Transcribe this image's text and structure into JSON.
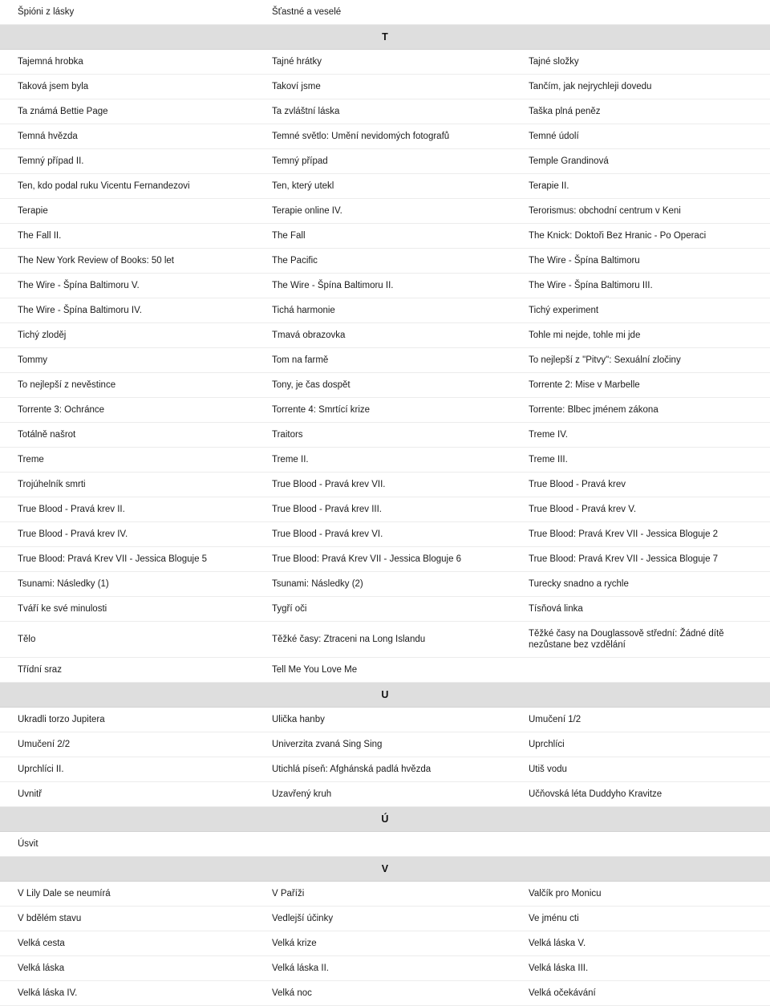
{
  "page": {
    "title": "Czech Title Index",
    "columns": 3,
    "colors": {
      "page_background": "#ffffff",
      "section_band_background": "#dedede",
      "row_separator": "#ececec",
      "text": "#1b1b1b"
    }
  },
  "blocks": [
    {
      "type": "rows",
      "rows": [
        [
          "Špióni z lásky",
          "Šťastné a veselé",
          ""
        ]
      ]
    },
    {
      "type": "section",
      "letter": "T"
    },
    {
      "type": "rows",
      "rows": [
        [
          "Tajemná hrobka",
          "Tajné hrátky",
          "Tajné složky"
        ],
        [
          "Taková jsem byla",
          "Takoví jsme",
          "Tančím, jak nejrychleji dovedu"
        ],
        [
          "Ta známá Bettie Page",
          "Ta zvláštní láska",
          "Taška plná peněz"
        ],
        [
          "Temná hvězda",
          "Temné světlo: Umění nevidomých fotografů",
          "Temné údolí"
        ],
        [
          "Temný případ II.",
          "Temný případ",
          "Temple Grandinová"
        ],
        [
          "Ten, kdo podal ruku Vicentu Fernandezovi",
          "Ten, který utekl",
          "Terapie II."
        ],
        [
          "Terapie",
          "Terapie online IV.",
          "Terorismus: obchodní centrum v Keni"
        ],
        [
          "The Fall II.",
          "The Fall",
          "The Knick: Doktoři Bez Hranic - Po Operaci"
        ],
        [
          "The New York Review of Books: 50 let",
          "The Pacific",
          "The Wire - Špína Baltimoru"
        ],
        [
          "The Wire - Špína Baltimoru V.",
          "The Wire - Špína Baltimoru II.",
          "The Wire - Špína Baltimoru III."
        ],
        [
          "The Wire - Špína Baltimoru IV.",
          "Tichá harmonie",
          "Tichý experiment"
        ],
        [
          "Tichý zloděj",
          "Tmavá obrazovka",
          "Tohle mi nejde, tohle mi jde"
        ],
        [
          "Tommy",
          "Tom na farmě",
          "To nejlepší z \"Pitvy\": Sexuální zločiny"
        ],
        [
          "To nejlepší z nevěstince",
          "Tony, je čas dospět",
          "Torrente 2: Mise v Marbelle"
        ],
        [
          "Torrente 3: Ochránce",
          "Torrente 4: Smrtící krize",
          "Torrente: Blbec jménem zákona"
        ],
        [
          "Totálně našrot",
          "Traitors",
          "Treme IV."
        ],
        [
          "Treme",
          "Treme II.",
          "Treme III."
        ],
        [
          "Trojúhelník smrti",
          "True Blood - Pravá krev VII.",
          "True Blood - Pravá krev"
        ],
        [
          "True Blood - Pravá krev II.",
          "True Blood - Pravá krev III.",
          "True Blood - Pravá krev V."
        ],
        [
          "True Blood - Pravá krev IV.",
          "True Blood - Pravá krev VI.",
          "True Blood: Pravá Krev VII - Jessica Bloguje 2"
        ],
        [
          "True Blood: Pravá Krev VII - Jessica Bloguje 5",
          "True Blood: Pravá Krev VII - Jessica Bloguje 6",
          "True Blood: Pravá Krev VII - Jessica Bloguje 7"
        ],
        [
          "Tsunami: Následky (1)",
          "Tsunami: Následky (2)",
          "Turecky snadno a rychle"
        ],
        [
          "Tváří ke své minulosti",
          "Tygří oči",
          "Tísňová linka"
        ]
      ]
    },
    {
      "type": "rows",
      "tall": true,
      "rows": [
        [
          "Tělo",
          "Těžké časy: Ztraceni na Long Islandu",
          "Těžké časy na Douglassově střední: Žádné dítě nezůstane bez vzdělání"
        ]
      ]
    },
    {
      "type": "rows",
      "rows": [
        [
          "Třídní sraz",
          "Tell Me You Love Me",
          ""
        ]
      ]
    },
    {
      "type": "section",
      "letter": "U"
    },
    {
      "type": "rows",
      "rows": [
        [
          "Ukradli torzo Jupitera",
          "Ulička hanby",
          "Umučení 1/2"
        ],
        [
          "Umučení 2/2",
          "Univerzita zvaná Sing Sing",
          "Uprchlíci"
        ],
        [
          "Uprchlíci II.",
          "Utichlá píseň: Afghánská padlá hvězda",
          "Utiš vodu"
        ],
        [
          "Uvnitř",
          "Uzavřený kruh",
          "Učňovská léta Duddyho Kravitze"
        ]
      ]
    },
    {
      "type": "section",
      "letter": "Ú"
    },
    {
      "type": "rows",
      "rows": [
        [
          "Úsvit",
          "",
          ""
        ]
      ]
    },
    {
      "type": "section",
      "letter": "V"
    },
    {
      "type": "rows",
      "rows": [
        [
          "V Lily Dale se neumírá",
          "V Paříži",
          "Valčík pro Monicu"
        ],
        [
          "V bdělém stavu",
          "Vedlejší účinky",
          "Ve jménu cti"
        ],
        [
          "Velká cesta",
          "Velká krize",
          "Velká láska V."
        ],
        [
          "Velká láska",
          "Velká láska II.",
          "Velká láska III."
        ],
        [
          "Velká láska IV.",
          "Velká noc",
          "Velká očekávání"
        ]
      ]
    }
  ]
}
